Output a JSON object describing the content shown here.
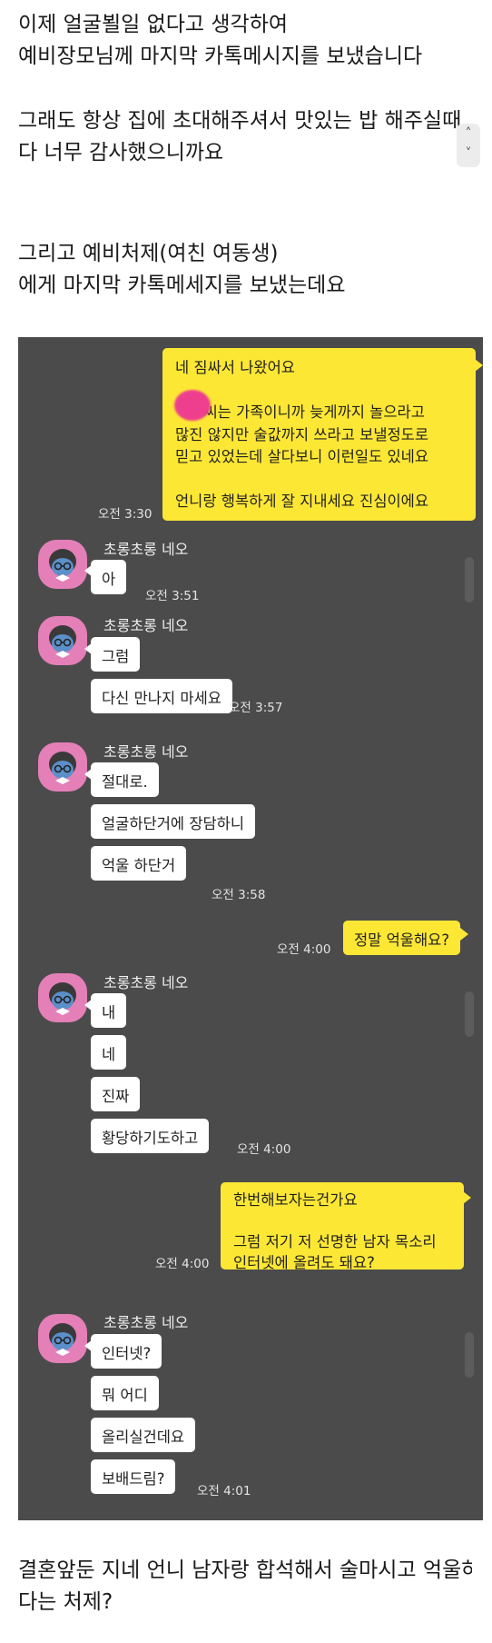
{
  "post": {
    "intro_lines": [
      "이제 얼굴뵐일 없다고 생각하여",
      "예비장모님께 마지막 카톡메시지를 보냈습니다"
    ],
    "mid_lines": [
      "그래도 항상 집에 초대해주셔서 맛있는 밥 해주실때마",
      "다 너무 감사했으니까요"
    ],
    "sister_lines": [
      "그리고 예비처제(여친 여동생)",
      "에게 마지막 카톡메세지를 보냈는데요"
    ],
    "closing_lines": [
      "결혼앞둔 지네 언니 남자랑 합석해서 술마시고 억울하",
      "다는 처제?"
    ]
  },
  "scroll_widget": {
    "up": "˄",
    "down": "˅"
  },
  "chat": {
    "sender_name": "초롱초롱 네오",
    "msg1": {
      "text": "네 짐싸서 나왔어요\n\n      씨는 가족이니까 늦게까지 놀으라고\n많진 않지만 술값까지 쓰라고 보낼정도로\n믿고 있었는데 살다보니 이런일도 있네요\n\n언니랑 행복하게 잘 지내세요 진심이에요",
      "time": "오전 3:30"
    },
    "group1": {
      "messages": [
        "아"
      ],
      "time": "오전 3:51"
    },
    "group2": {
      "messages": [
        "그럼",
        "다신 만나지 마세요"
      ],
      "time": "오전 3:57"
    },
    "group3": {
      "messages": [
        "절대로.",
        "얼굴하단거에 장담하니",
        "억울 하단거"
      ],
      "time": "오전 3:58"
    },
    "msg2": {
      "text": "정말 억울해요?",
      "time": "오전 4:00"
    },
    "group4": {
      "messages": [
        "내",
        "네",
        "진짜",
        "황당하기도하고"
      ],
      "time": "오전 4:00"
    },
    "msg3": {
      "text": "한번해보자는건가요\n\n그럼 저기 저 선명한 남자 목소리\n인터넷에 올려도 돼요?",
      "time": "오전 4:00"
    },
    "group5": {
      "messages": [
        "인터넷?",
        "뭐 어디",
        "올리실건데요",
        "보배드림?"
      ],
      "time": "오전 4:01"
    }
  },
  "colors": {
    "chat_bg": "#4b4b4b",
    "my_bubble": "#fde735",
    "other_bubble": "#ffffff",
    "avatar_bg": "#e47fb8",
    "redaction": "#ee3f8f"
  }
}
